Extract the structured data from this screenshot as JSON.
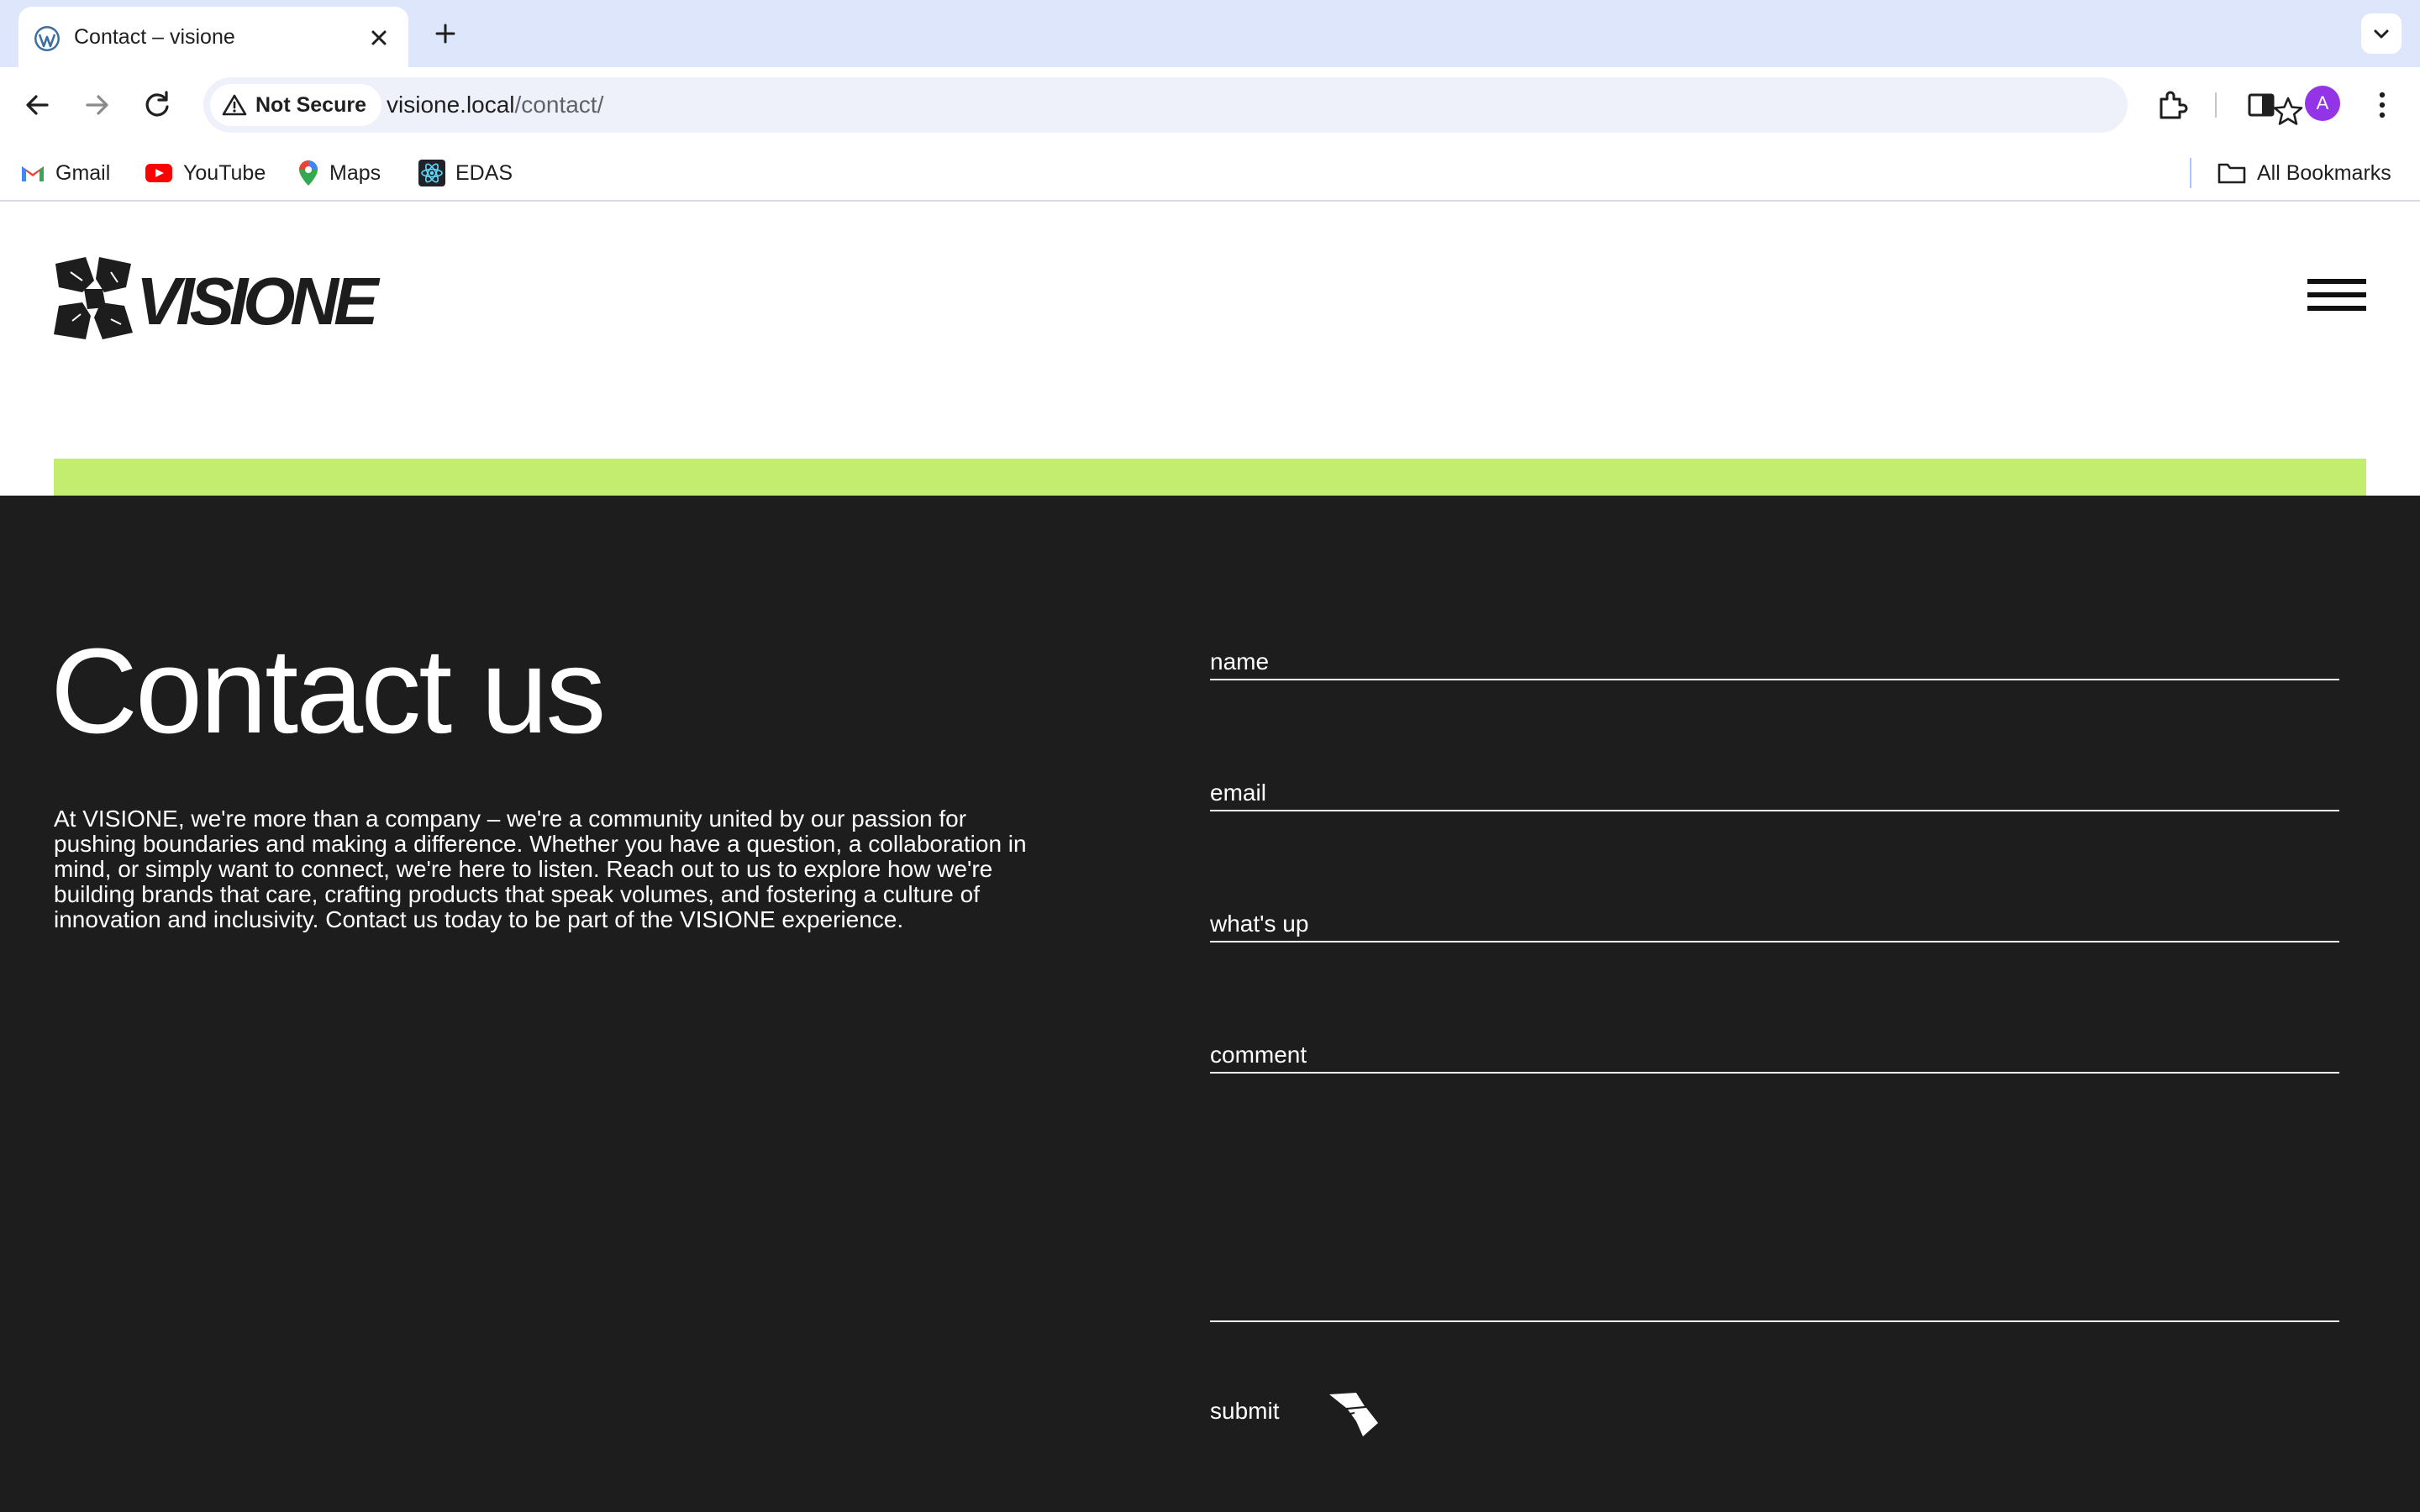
{
  "browser": {
    "tab_title": "Contact – visione",
    "security_label": "Not Secure",
    "url_host": "visione.local",
    "url_path": "/contact/",
    "profile_initial": "A",
    "bookmarks": [
      {
        "label": "Gmail",
        "icon": "gmail-icon"
      },
      {
        "label": "YouTube",
        "icon": "youtube-icon"
      },
      {
        "label": "Maps",
        "icon": "maps-icon"
      },
      {
        "label": "EDAS",
        "icon": "react-icon"
      }
    ],
    "all_bookmarks_label": "All Bookmarks"
  },
  "site": {
    "logo_text": "VISIONE",
    "accent_color": "#c3ed6f",
    "dark_bg": "#1d1d1d"
  },
  "contact": {
    "title": "Contact us",
    "intro": "At VISIONE, we're more than a company – we're a community united by our passion for pushing boundaries and making a difference. Whether you have a question, a collaboration in mind, or simply want to connect, we're here to listen. Reach out to us to explore how we're building brands that care, crafting products that speak volumes, and fostering a culture of innovation and inclusivity. Contact us today to be part of the VISIONE experience.",
    "form": {
      "name_label": "name",
      "email_label": "email",
      "subject_label": "what's up",
      "comment_label": "comment",
      "submit_label": "submit"
    }
  }
}
